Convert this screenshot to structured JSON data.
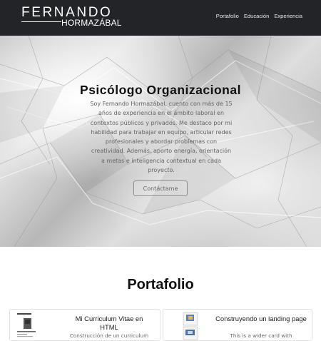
{
  "brand": {
    "first_name": "FERNANDO",
    "last_name": "HORMAZÁBAL"
  },
  "nav": {
    "items": [
      "Portafolio",
      "Educación",
      "Experiencia"
    ]
  },
  "hero": {
    "title": "Psicólogo Organizacional",
    "lines": [
      "Soy Fernando Hormazábal, cuento con más de 15",
      "años de experiencia en el ámbito laboral en",
      "contextos públicos y privados. Me destaco por mi",
      "habilidad para trabajar en equipo, articular redes",
      "profesionales y abordar problemas con",
      "creatividad. Además, aporto energía, orientación",
      "a metas e inteligencia contextual en cada",
      "proyecto."
    ],
    "button": "Contáctame"
  },
  "portfolio": {
    "title": "Portafolio",
    "cards": [
      {
        "title": "Mi Curriculum Vitae en HTML",
        "text": "Construcción de un curriculum"
      },
      {
        "title": "Construyendo un landing page",
        "text": "This is a wider card with"
      }
    ]
  }
}
